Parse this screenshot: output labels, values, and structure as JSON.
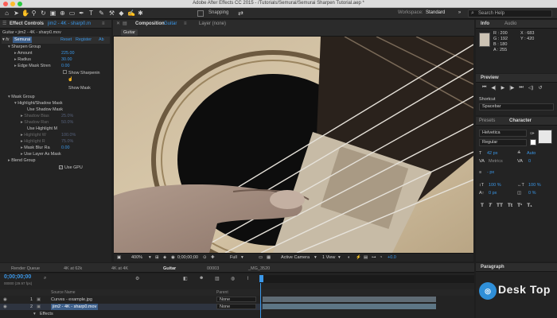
{
  "window": {
    "title": "Adobe After Effects CC 2015 - /Tutorials/Semurai/Semurai Sharpen Tutorial.aep *"
  },
  "toolbar": {
    "snapping_label": "Snapping",
    "workspace_label": "Workspace:",
    "workspace_value": "Standard",
    "search_placeholder": "Search Help"
  },
  "effect_controls": {
    "tab_label": "Effect Controls",
    "tab_layer": "jim2 - 4K - sharp0.m",
    "breadcrumb": "Guitar • jim2 - 4K - sharp0.mov",
    "effect_name": "Semurai",
    "reset_label": "Reset",
    "register_label": "Register",
    "about_label": "Ab",
    "rows": {
      "sharpen_group": "Sharpen Group",
      "amount": "Amount",
      "amount_val": "225.00",
      "radius": "Radius",
      "radius_val": "30.00",
      "edge_mask": "Edge Mask Stren",
      "edge_mask_val": "0.00",
      "show_sharpening": "Show Sharpenin",
      "show_mask": "Show Mask",
      "mask_group": "Mask Group",
      "highlight_shadow_mask": "Highlight/Shadow Mask",
      "use_shadow_mask": "Use Shadow Mask",
      "shadow_bias": "Shadow Bias",
      "shadow_bias_val": "25.0%",
      "shadow_range": "Shadow Ran",
      "shadow_range_val": "50.0%",
      "use_highlight_mask": "Use Highlight M",
      "highlight_w": "Highlight W",
      "highlight_w_val": "100.0%",
      "highlight_r": "Highlight R",
      "highlight_r_val": "75.0%",
      "mask_blur": "Mask Blur Ra",
      "mask_blur_val": "0.00",
      "use_layer_as_mask": "Use Layer As Mask",
      "blend_group": "Blend Group",
      "use_gpu": "Use GPU"
    }
  },
  "composition": {
    "tab_label": "Composition",
    "tab_comp": "Guitar",
    "layer_tab": "Layer (none)",
    "comp_chip": "Guitar"
  },
  "viewer_bar": {
    "zoom": "400%",
    "timecode": "0;00;00;00",
    "resolution": "Full",
    "camera": "Active Camera",
    "view": "1 View",
    "exposure": "+0.0"
  },
  "info": {
    "tab_label": "Info",
    "audio_label": "Audio",
    "r": "R : 200",
    "g": "G : 192",
    "b": "B : 180",
    "a": "A : 255",
    "x": "X : 683",
    "y": "Y : 420"
  },
  "preview": {
    "tab_label": "Preview",
    "shortcut_label": "Shortcut",
    "shortcut_value": "Spacebar"
  },
  "character": {
    "presets_label": "Presets",
    "tab_label": "Character",
    "font": "Helvetica",
    "style": "Regular",
    "size": "42 px",
    "leading": "Auto",
    "kerning": "Metrics",
    "tracking": "0",
    "indent": "- px",
    "v_scale": "100 %",
    "h_scale": "100 %",
    "baseline": "0 px",
    "tsume": "0 %"
  },
  "paragraph": {
    "tab_label": "Paragraph"
  },
  "timeline": {
    "tabs": [
      "Render Queue",
      "4K at 62k",
      "4K at 4K",
      "Guitar",
      "00003",
      "_MG_3520"
    ],
    "timecode": "0;00;00;00",
    "fps": "00000 (29.97 fps)",
    "col_source": "Source Name",
    "col_parent": "Parent",
    "layers": [
      {
        "num": "1",
        "name": "Curves - example.jpg",
        "parent": "None"
      },
      {
        "num": "2",
        "name": "jim2 - 4K - sharp0.mov",
        "parent": "None"
      }
    ],
    "effects_label": "Effects"
  },
  "watermark": {
    "text": "Desk Top"
  }
}
